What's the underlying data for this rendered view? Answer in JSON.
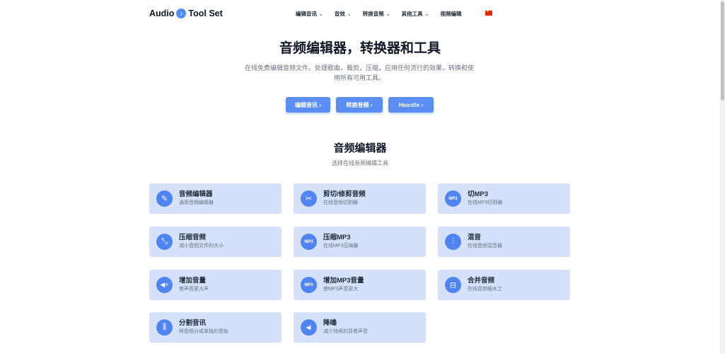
{
  "header": {
    "logo_left": "Audio",
    "logo_right": "Tool Set",
    "nav": [
      {
        "label": "编辑音讯",
        "has_dropdown": true
      },
      {
        "label": "音效",
        "has_dropdown": true
      },
      {
        "label": "转换音频",
        "has_dropdown": true
      },
      {
        "label": "其他工具",
        "has_dropdown": true
      },
      {
        "label": "视频编辑",
        "has_dropdown": false
      }
    ],
    "chevron": "⌄",
    "language_flag": "china-flag-icon"
  },
  "hero": {
    "title": "音频编辑器，转换器和工具",
    "subtitle": "在线免费编辑音频文件。处理歌曲，裁剪，压缩，应用任何流行的效果，转换和使用所有可用工具。",
    "buttons": [
      {
        "label": "编辑音讯 ›"
      },
      {
        "label": "转换音频 ›"
      },
      {
        "label": "Heardle ›"
      }
    ]
  },
  "section": {
    "title": "音频编辑器",
    "subtitle": "选择在线音频编辑工具"
  },
  "cards": [
    {
      "title": "音频编辑器",
      "desc": "通用音频编辑器",
      "icon": "pencil-icon",
      "glyph": "✎"
    },
    {
      "title": "剪切/修剪音频",
      "desc": "在线音频切割器",
      "icon": "scissors-icon",
      "glyph": "✂"
    },
    {
      "title": "切MP3",
      "desc": "在线MP3切割器",
      "icon": "mp3-cut-icon",
      "glyph": "MP3"
    },
    {
      "title": "压缩音频",
      "desc": "减小音频文件的大小",
      "icon": "compress-icon",
      "glyph": "⤡"
    },
    {
      "title": "压缩MP3",
      "desc": "在线MP3压缩器",
      "icon": "mp3-compress-icon",
      "glyph": "MP3"
    },
    {
      "title": "混音",
      "desc": "在线音频混音器",
      "icon": "mixer-icon",
      "glyph": "⫶"
    },
    {
      "title": "增加音量",
      "desc": "使声音更大声",
      "icon": "volume-up-icon",
      "glyph": "◀+"
    },
    {
      "title": "增加MP3音量",
      "desc": "使MP3声音更大",
      "icon": "mp3-volume-icon",
      "glyph": "MP3"
    },
    {
      "title": "合并音频",
      "desc": "在线音频细木工",
      "icon": "merge-icon",
      "glyph": "⊟"
    },
    {
      "title": "分割音讯",
      "desc": "将音频分成单独的音轨",
      "icon": "split-icon",
      "glyph": "⫼"
    },
    {
      "title": "降噪",
      "desc": "减少持续的背景声音",
      "icon": "noise-reduction-icon",
      "glyph": "◀⦚"
    }
  ],
  "colors": {
    "accent": "#4f85f2",
    "card_bg": "#d5e1fb",
    "button": "#5b8ef5"
  }
}
